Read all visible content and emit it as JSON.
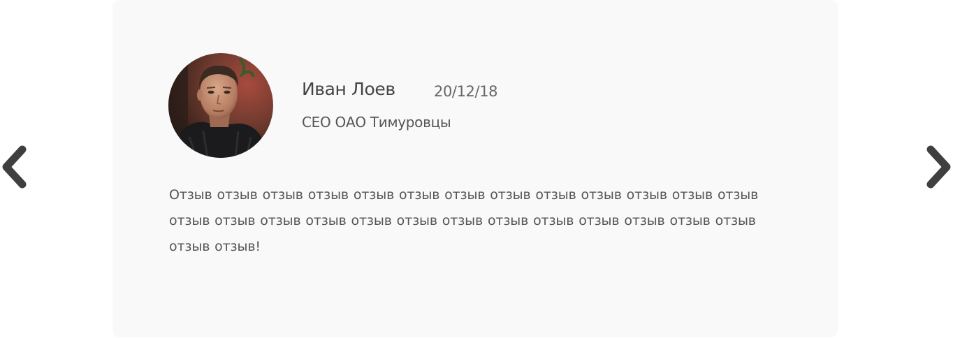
{
  "review": {
    "author_name": "Иван Лоев",
    "date": "20/12/18",
    "position": "CEO ОАО Тимуровцы",
    "text": "Отзыв отзыв отзыв отзыв отзыв отзыв отзыв отзыв отзыв отзыв отзыв отзыв отзыв отзыв отзыв отзыв отзыв отзыв отзыв отзыв отзыв отзыв отзыв отзыв отзыв отзыв отзыв отзыв!"
  },
  "navigation": {
    "prev_icon": "chevron-left-icon",
    "next_icon": "chevron-right-icon"
  },
  "colors": {
    "card_background": "#f9f9f9",
    "arrow": "#3f3f3f",
    "name_text": "#444444",
    "body_text": "#555555"
  }
}
